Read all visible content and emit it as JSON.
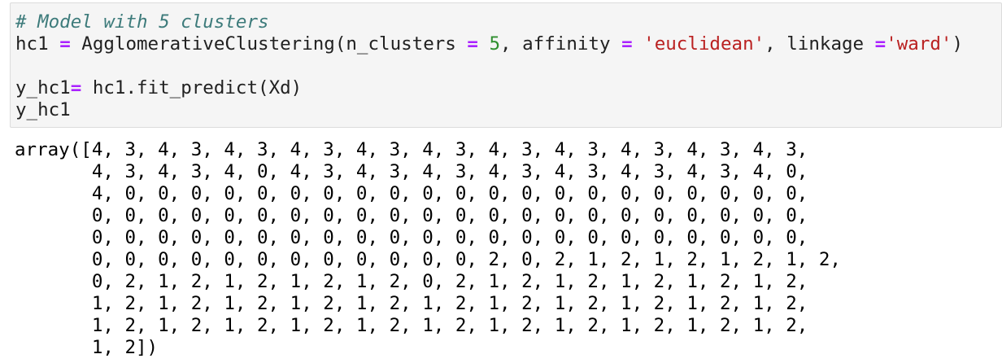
{
  "cell": {
    "comment": "# Model with 5 clusters",
    "line2": {
      "var": "hc1",
      "op_assign": "=",
      "call_open": "AgglomerativeClustering(n_clusters",
      "op_eq1": "=",
      "n_clusters": "5",
      "mid1": ", affinity",
      "op_eq2": "=",
      "affinity": "'euclidean'",
      "mid2": ", linkage",
      "op_eq3": "=",
      "linkage": "'ward'",
      "close": ")"
    },
    "line4": {
      "var": "y_hc1",
      "op_assign": "=",
      "rest": " hc1.fit_predict(Xd)"
    },
    "line5": "y_hc1"
  },
  "output": {
    "lines": [
      "array([4, 3, 4, 3, 4, 3, 4, 3, 4, 3, 4, 3, 4, 3, 4, 3, 4, 3, 4, 3, 4, 3,",
      "       4, 3, 4, 3, 4, 0, 4, 3, 4, 3, 4, 3, 4, 3, 4, 3, 4, 3, 4, 3, 4, 0,",
      "       4, 0, 0, 0, 0, 0, 0, 0, 0, 0, 0, 0, 0, 0, 0, 0, 0, 0, 0, 0, 0, 0,",
      "       0, 0, 0, 0, 0, 0, 0, 0, 0, 0, 0, 0, 0, 0, 0, 0, 0, 0, 0, 0, 0, 0,",
      "       0, 0, 0, 0, 0, 0, 0, 0, 0, 0, 0, 0, 0, 0, 0, 0, 0, 0, 0, 0, 0, 0,",
      "       0, 0, 0, 0, 0, 0, 0, 0, 0, 0, 0, 0, 2, 0, 2, 1, 2, 1, 2, 1, 2, 1, 2,",
      "       0, 2, 1, 2, 1, 2, 1, 2, 1, 2, 0, 2, 1, 2, 1, 2, 1, 2, 1, 2, 1, 2,",
      "       1, 2, 1, 2, 1, 2, 1, 2, 1, 2, 1, 2, 1, 2, 1, 2, 1, 2, 1, 2, 1, 2,",
      "       1, 2, 1, 2, 1, 2, 1, 2, 1, 2, 1, 2, 1, 2, 1, 2, 1, 2, 1, 2, 1, 2,",
      "       1, 2])"
    ]
  }
}
